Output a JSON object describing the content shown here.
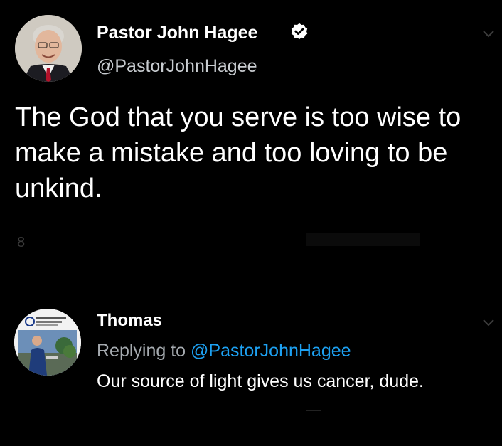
{
  "main_tweet": {
    "display_name": "Pastor John Hagee",
    "handle": "@PastorJohnHagee",
    "text": "The God that you serve is too wise to make a mistake and too loving to be unkind.",
    "faded_stat": "8"
  },
  "reply": {
    "display_name": "Thomas",
    "replying_prefix": "Replying to ",
    "replying_handle": "@PastorJohnHagee",
    "text": "Our source of light gives us cancer, dude."
  },
  "colors": {
    "background": "#000000",
    "text": "#ffffff",
    "secondary_text": "#a6abb0",
    "mention": "#1da1f2"
  },
  "icons": {
    "verified": "verified-badge-icon",
    "chevron": "chevron-down-icon"
  }
}
